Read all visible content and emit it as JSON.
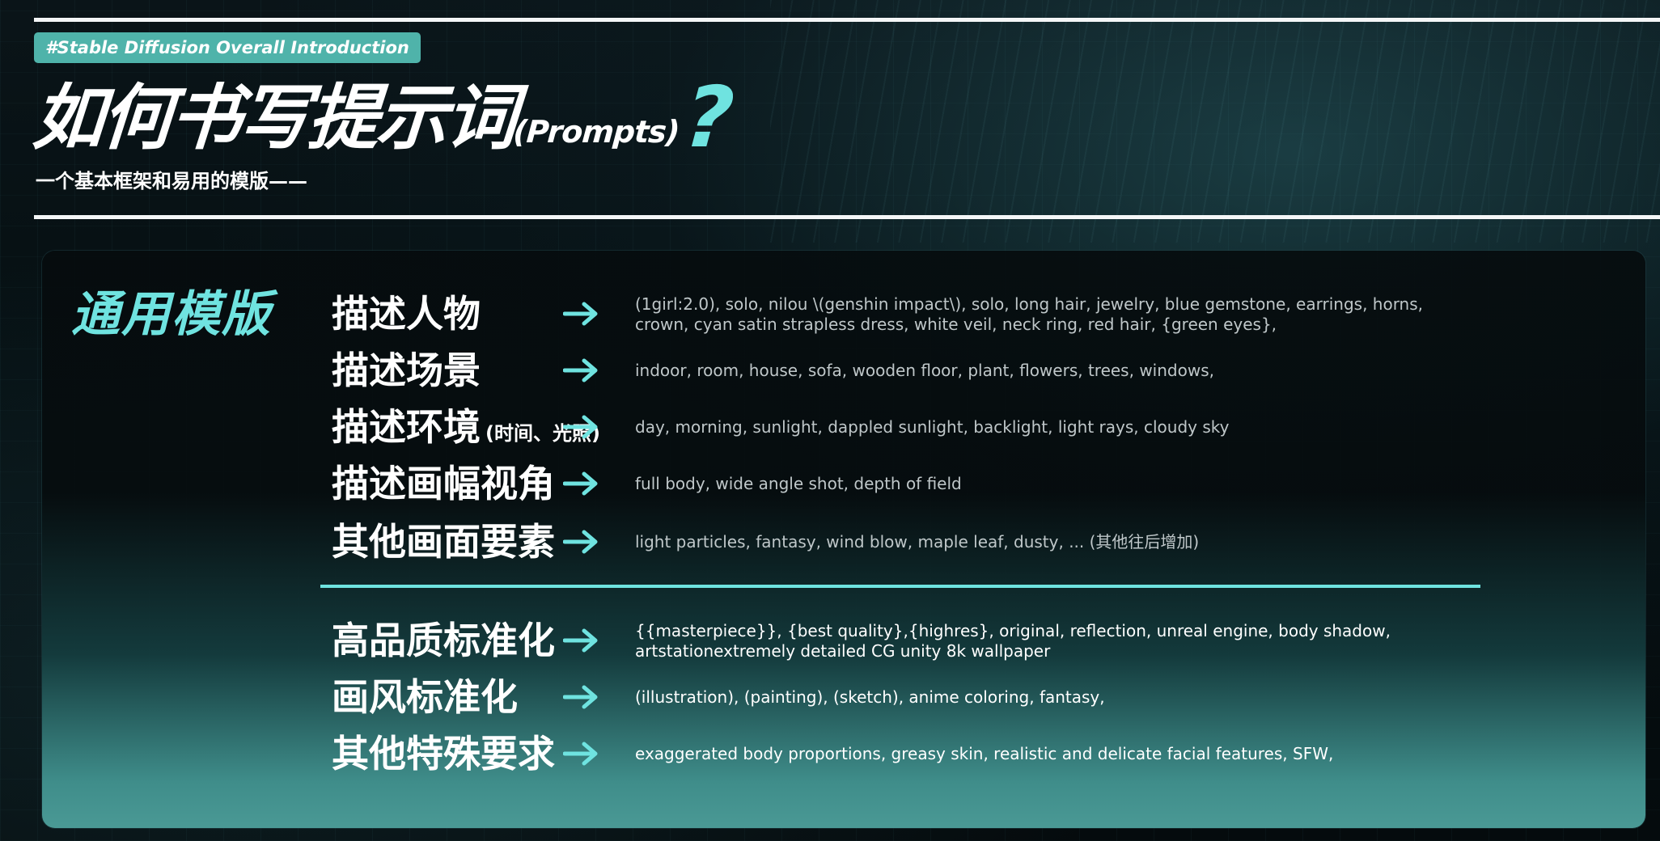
{
  "header": {
    "tag": "#Stable Diffusion Overall Introduction",
    "title_main": "如何书写提示词",
    "title_paren": "(Prompts)",
    "title_mark": "?",
    "subtitle": "一个基本框架和易用的模版——"
  },
  "template": {
    "label": "通用模版",
    "rows": [
      {
        "label": "描述人物",
        "note": "",
        "value": "(1girl:2.0), solo, nilou \\(genshin impact\\), solo, long hair, jewelry, blue gemstone, earrings, horns, crown, cyan satin strapless dress, white veil, neck ring, red hair, {green eyes},"
      },
      {
        "label": "描述场景",
        "note": "",
        "value": "indoor, room, house, sofa, wooden floor, plant, flowers, trees, windows,"
      },
      {
        "label": "描述环境",
        "note": "(时间、光照)",
        "value": "day, morning, sunlight, dappled sunlight, backlight, light rays, cloudy sky"
      },
      {
        "label": "描述画幅视角",
        "note": "",
        "value": "full body, wide angle shot, depth of field"
      },
      {
        "label": "其他画面要素",
        "note": "",
        "value": "light particles, fantasy, wind blow, maple leaf, dusty, ... (其他往后增加)"
      }
    ],
    "lower_rows": [
      {
        "label": "高品质标准化",
        "value": "{{masterpiece}}, {best quality},{highres}, original, reflection, unreal engine, body shadow, artstationextremely detailed CG unity 8k wallpaper"
      },
      {
        "label": "画风标准化",
        "value": "(illustration), (painting), (sketch), anime coloring, fantasy,"
      },
      {
        "label": "其他特殊要求",
        "value": "exaggerated body proportions, greasy skin, realistic and delicate facial features, SFW,"
      }
    ]
  },
  "colors": {
    "accent": "#6fe3e0",
    "tag_bg": "#4fb3aa",
    "text": "#ffffff",
    "muted": "#bfc7c9"
  },
  "icons": {
    "arrow": "arrow-right-icon"
  }
}
